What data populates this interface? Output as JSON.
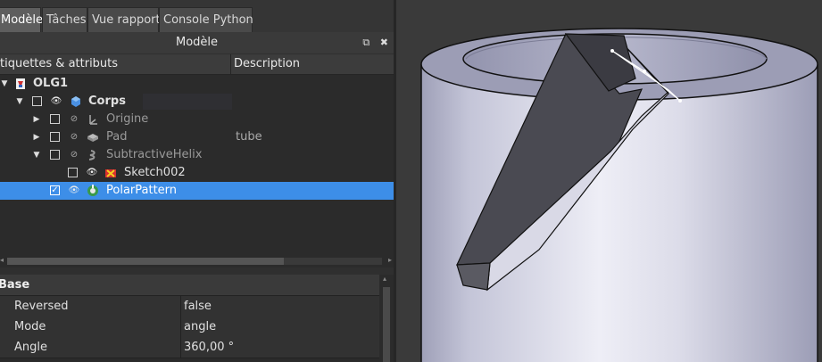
{
  "tabs": [
    {
      "label": "Modèle",
      "active": true
    },
    {
      "label": "Tâches"
    },
    {
      "label": "Vue rapport"
    },
    {
      "label": "Console Python"
    }
  ],
  "panel": {
    "title": "Modèle",
    "float_icon": "float-icon",
    "close_icon": "close-icon"
  },
  "tree_header": {
    "col1": "tiquettes & attributs",
    "col2": "Description"
  },
  "tree": [
    {
      "label": "OLG1",
      "description": "",
      "icon": "document-icon",
      "bold": true
    },
    {
      "label": "Corps",
      "description": "",
      "icon": "body-icon",
      "bold": true
    },
    {
      "label": "Origine",
      "description": "",
      "icon": "origin-icon"
    },
    {
      "label": "Pad",
      "description": "tube",
      "icon": "pad-icon"
    },
    {
      "label": "SubtractiveHelix",
      "description": "",
      "icon": "helix-icon"
    },
    {
      "label": "Sketch002",
      "description": "",
      "icon": "sketch-icon"
    },
    {
      "label": "PolarPattern",
      "description": "",
      "icon": "polar-pattern-icon",
      "selected": true
    }
  ],
  "properties": {
    "group": "Base",
    "rows": [
      {
        "name": "Reversed",
        "value": "false"
      },
      {
        "name": "Mode",
        "value": "angle"
      },
      {
        "name": "Angle",
        "value": "360,00 °"
      }
    ]
  },
  "viewport": {
    "object": "tube-with-helical-cut"
  }
}
